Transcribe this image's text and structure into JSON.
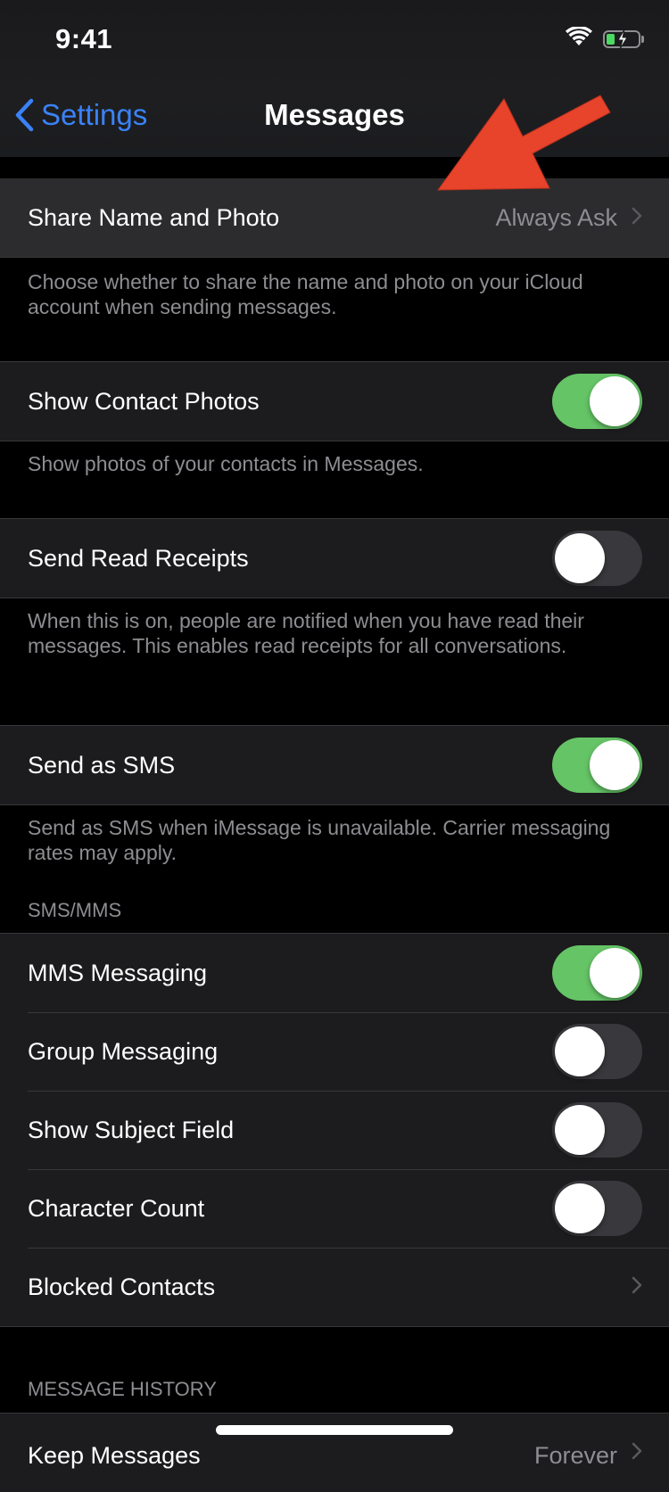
{
  "status_bar": {
    "time": "9:41",
    "icons": [
      "wifi-icon",
      "battery-charging-icon"
    ]
  },
  "nav": {
    "back_label": "Settings",
    "title": "Messages"
  },
  "annotation": {
    "type": "arrow",
    "color": "#e8432b",
    "points_to": "Share Name and Photo"
  },
  "groups": [
    {
      "rows": [
        {
          "label": "Share Name and Photo",
          "value": "Always Ask",
          "accessory": "chevron"
        }
      ],
      "footer": "Choose whether to share the name and photo on your iCloud account when sending messages."
    },
    {
      "rows": [
        {
          "label": "Show Contact Photos",
          "toggle": true
        }
      ],
      "footer": "Show photos of your contacts in Messages."
    },
    {
      "rows": [
        {
          "label": "Send Read Receipts",
          "toggle": false
        }
      ],
      "footer": "When this is on, people are notified when you have read their messages. This enables read receipts for all conversations."
    },
    {
      "rows": [
        {
          "label": "Send as SMS",
          "toggle": true
        }
      ],
      "footer": "Send as SMS when iMessage is unavailable. Carrier messaging rates may apply."
    },
    {
      "header": "SMS/MMS",
      "rows": [
        {
          "label": "MMS Messaging",
          "toggle": true
        },
        {
          "label": "Group Messaging",
          "toggle": false
        },
        {
          "label": "Show Subject Field",
          "toggle": false
        },
        {
          "label": "Character Count",
          "toggle": false
        },
        {
          "label": "Blocked Contacts",
          "accessory": "chevron"
        }
      ]
    },
    {
      "header": "MESSAGE HISTORY",
      "rows": [
        {
          "label": "Keep Messages",
          "value": "Forever",
          "accessory": "chevron"
        }
      ]
    }
  ],
  "colors": {
    "accent": "#3a82f7",
    "toggle_on": "#65c466",
    "toggle_off": "#39393d",
    "row_bg": "#1c1c1e",
    "highlight_row_bg": "#2c2c2e",
    "secondary_text": "#8d8d92"
  }
}
